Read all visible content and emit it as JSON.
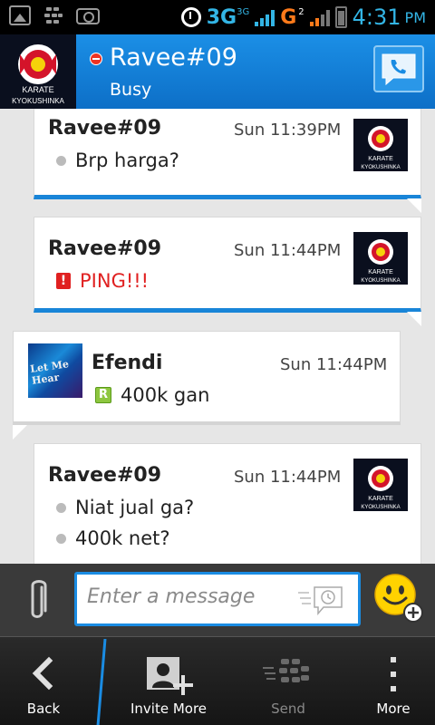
{
  "status_bar": {
    "network_1": "3G",
    "network_1_small": "3G",
    "network_2": "G",
    "network_2_small": "2",
    "time": "4:31",
    "ampm": "PM"
  },
  "header": {
    "avatar_text_top": "KARATE",
    "avatar_text_bottom": "KYOKUSHINKA",
    "contact_name": "Ravee#09",
    "contact_status": "Busy",
    "status_color": "#e33322",
    "accent": "#1985d8"
  },
  "messages": [
    {
      "sender": "Ravee#09",
      "time": "Sun 11:39PM",
      "lines": [
        "Brp harga?"
      ],
      "type": "text"
    },
    {
      "sender": "Ravee#09",
      "time": "Sun 11:44PM",
      "lines": [
        "PING!!!"
      ],
      "type": "ping"
    },
    {
      "sender": "Efendi",
      "time": "Sun 11:44PM",
      "lines": [
        "400k gan"
      ],
      "type": "read",
      "avatar_text": "Let Me Hear"
    },
    {
      "sender": "Ravee#09",
      "time": "Sun 11:44PM",
      "lines": [
        "Niat jual ga?",
        "400k net?"
      ],
      "type": "text"
    }
  ],
  "compose": {
    "placeholder": "Enter a message",
    "value": ""
  },
  "actions": [
    {
      "label": "Back",
      "icon": "back-arrow-icon"
    },
    {
      "label": "Invite More",
      "icon": "add-contact-icon"
    },
    {
      "label": "Send",
      "icon": "bbm-send-icon",
      "disabled": true
    },
    {
      "label": "More",
      "icon": "overflow-menu-icon"
    }
  ]
}
